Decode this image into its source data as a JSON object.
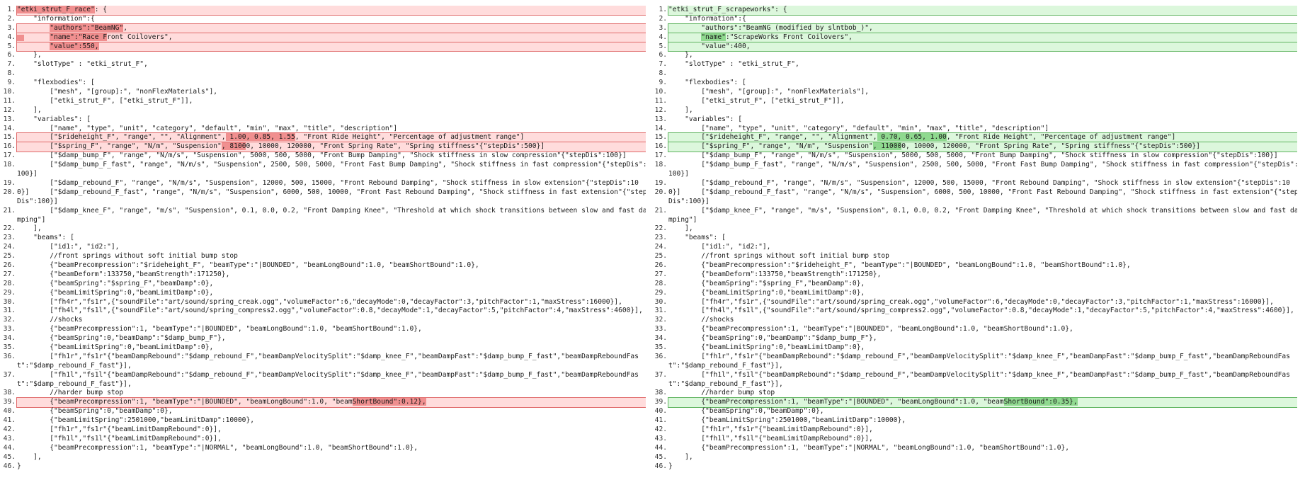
{
  "left": {
    "name": "left-pane",
    "lines": [
      {
        "n": "1.",
        "t": "\"etki_strut_F_race\": {",
        "k": "del",
        "h": [
          [
            0,
            19
          ]
        ]
      },
      {
        "n": "2.",
        "t": "    \"information\":{",
        "k": "n"
      },
      {
        "n": "3.",
        "t": "        \"authors\":\"BeamNG\",",
        "k": "del",
        "h": [
          [
            8,
            26
          ]
        ]
      },
      {
        "n": "4.",
        "t": "        \"name\":\"Race Front Coilovers\",",
        "k": "del",
        "h": [
          [
            8,
            22
          ]
        ],
        "g": true
      },
      {
        "n": "5.",
        "t": "        \"value\":550,",
        "k": "del",
        "h": [
          [
            8,
            20
          ]
        ]
      },
      {
        "n": "6.",
        "t": "    },",
        "k": "n"
      },
      {
        "n": "7.",
        "t": "    \"slotType\" : \"etki_strut_F\",",
        "k": "n"
      },
      {
        "n": "8.",
        "t": "",
        "k": "n"
      },
      {
        "n": "9.",
        "t": "    \"flexbodies\": [",
        "k": "n"
      },
      {
        "n": "10.",
        "t": "        [\"mesh\", \"[group]:\", \"nonFlexMaterials\"],",
        "k": "n"
      },
      {
        "n": "11.",
        "t": "        [\"etki_strut_F\", [\"etki_strut_F\"]],",
        "k": "n"
      },
      {
        "n": "12.",
        "t": "    ],",
        "k": "n"
      },
      {
        "n": "13.",
        "t": "    \"variables\": [",
        "k": "n"
      },
      {
        "n": "14.",
        "t": "        [\"name\", \"type\", \"unit\", \"category\", \"default\", \"min\", \"max\", \"title\", \"description\"]",
        "k": "n"
      },
      {
        "n": "15.",
        "t": "        [\"$rideheight_F\", \"range\", \"\", \"Alignment\", 1.00, 0.85, 1.55, \"Front Ride Height\", \"Percentage of adjustment range\"]",
        "k": "del",
        "h": [
          [
            51,
            68
          ]
        ]
      },
      {
        "n": "16.",
        "t": "        [\"$spring_F\", \"range\", \"N/m\", \"Suspension\", 81000, 10000, 120000, \"Front Spring Rate\", \"Spring stiffness\"{\"stepDis\":500}]",
        "k": "del",
        "h": [
          [
            50,
            56
          ]
        ]
      },
      {
        "n": "17.",
        "t": "        [\"$damp_bump_F\", \"range\", \"N/m/s\", \"Suspension\", 5000, 500, 5000, \"Front Bump Damping\", \"Shock stiffness in slow compression\"{\"stepDis\":100}]",
        "k": "n"
      },
      {
        "n": "18.",
        "t": "        [\"$damp_bump_F_fast\", \"range\", \"N/m/s\", \"Suspension\", 2500, 500, 5000, \"Front Fast Bump Damping\", \"Shock stiffness in fast compression\"{\"stepDis\":100}]",
        "k": "n",
        "tall": true
      },
      {
        "n": "19.",
        "t": "        [\"$damp_rebound_F\", \"range\", \"N/m/s\", \"Suspension\", 12000, 500, 15000, \"Front Rebound Damping\", \"Shock stiffness in slow extension\"{\"stepDis\":100}]",
        "k": "n"
      },
      {
        "n": "20.",
        "t": "        [\"$damp_rebound_F_fast\", \"range\", \"N/m/s\", \"Suspension\", 6000, 500, 10000, \"Front Fast Rebound Damping\", \"Shock stiffness in fast extension\"{\"stepDis\":100}]",
        "k": "n",
        "tall": true
      },
      {
        "n": "21.",
        "t": "        [\"$damp_knee_F\", \"range\", \"m/s\", \"Suspension\", 0.1, 0.0, 0.2, \"Front Damping Knee\", \"Threshold at which shock transitions between slow and fast damping\"]",
        "k": "n",
        "tall": true
      },
      {
        "n": "22.",
        "t": "    ],",
        "k": "n"
      },
      {
        "n": "23.",
        "t": "    \"beams\": [",
        "k": "n"
      },
      {
        "n": "24.",
        "t": "        [\"id1:\", \"id2:\"],",
        "k": "n"
      },
      {
        "n": "25.",
        "t": "        //front springs without soft initial bump stop",
        "k": "n"
      },
      {
        "n": "26.",
        "t": "        {\"beamPrecompression\":\"$rideheight_F\", \"beamType\":\"|BOUNDED\", \"beamLongBound\":1.0, \"beamShortBound\":1.0},",
        "k": "n"
      },
      {
        "n": "27.",
        "t": "        {\"beamDeform\":133750,\"beamStrength\":171250},",
        "k": "n"
      },
      {
        "n": "28.",
        "t": "        {\"beamSpring\":\"$spring_F\",\"beamDamp\":0},",
        "k": "n"
      },
      {
        "n": "29.",
        "t": "        {\"beamLimitSpring\":0,\"beamLimitDamp\":0},",
        "k": "n"
      },
      {
        "n": "30.",
        "t": "        [\"fh4r\",\"fs1r\",{\"soundFile\":\"art/sound/spring_creak.ogg\",\"volumeFactor\":6,\"decayMode\":0,\"decayFactor\":3,\"pitchFactor\":1,\"maxStress\":16000}],",
        "k": "n"
      },
      {
        "n": "31.",
        "t": "        [\"fh4l\",\"fs1l\",{\"soundFile\":\"art/sound/spring_compress2.ogg\",\"volumeFactor\":0.8,\"decayMode\":1,\"decayFactor\":5,\"pitchFactor\":4,\"maxStress\":4600}],",
        "k": "n"
      },
      {
        "n": "32.",
        "t": "        //shocks",
        "k": "n"
      },
      {
        "n": "33.",
        "t": "        {\"beamPrecompression\":1, \"beamType\":\"|BOUNDED\", \"beamLongBound\":1.0, \"beamShortBound\":1.0},",
        "k": "n"
      },
      {
        "n": "34.",
        "t": "        {\"beamSpring\":0,\"beamDamp\":\"$damp_bump_F\"},",
        "k": "n"
      },
      {
        "n": "35.",
        "t": "        {\"beamLimitSpring\":0,\"beamLimitDamp\":0},",
        "k": "n"
      },
      {
        "n": "36.",
        "t": "        [\"fh1r\",\"fs1r\"{\"beamDampRebound\":\"$damp_rebound_F\",\"beamDampVelocitySplit\":\"$damp_knee_F\",\"beamDampFast\":\"$damp_bump_F_fast\",\"beamDampReboundFast\":\"$damp_rebound_F_fast\"}],",
        "k": "n",
        "tall": true
      },
      {
        "n": "37.",
        "t": "        [\"fh1l\",\"fs1l\"{\"beamDampRebound\":\"$damp_rebound_F\",\"beamDampVelocitySplit\":\"$damp_knee_F\",\"beamDampFast\":\"$damp_bump_F_fast\",\"beamDampReboundFast\":\"$damp_rebound_F_fast\"}],",
        "k": "n",
        "tall": true
      },
      {
        "n": "38.",
        "t": "        //harder bump stop",
        "k": "n"
      },
      {
        "n": "39.",
        "t": "        {\"beamPrecompression\":1, \"beamType\":\"|BOUNDED\", \"beamLongBound\":1.0, \"beamShortBound\":0.12},",
        "k": "del",
        "h": [
          [
            82,
            103
          ]
        ]
      },
      {
        "n": "40.",
        "t": "        {\"beamSpring\":0,\"beamDamp\":0},",
        "k": "n"
      },
      {
        "n": "41.",
        "t": "        {\"beamLimitSpring\":2501000,\"beamLimitDamp\":10000},",
        "k": "n"
      },
      {
        "n": "42.",
        "t": "        [\"fh1r\",\"fs1r\"{\"beamLimitDampRebound\":0}],",
        "k": "n"
      },
      {
        "n": "43.",
        "t": "        [\"fh1l\",\"fs1l\"{\"beamLimitDampRebound\":0}],",
        "k": "n"
      },
      {
        "n": "44.",
        "t": "        {\"beamPrecompression\":1, \"beamType\":\"|NORMAL\", \"beamLongBound\":1.0, \"beamShortBound\":1.0},",
        "k": "n"
      },
      {
        "n": "45.",
        "t": "    ],",
        "k": "n"
      },
      {
        "n": "46.",
        "t": "}",
        "k": "n"
      }
    ]
  },
  "right": {
    "name": "right-pane",
    "lines": [
      {
        "n": "1.",
        "t": "\"etki_strut_F_scrapeworks\": {",
        "k": "add",
        "h": []
      },
      {
        "n": "2.",
        "t": "    \"information\":{",
        "k": "n"
      },
      {
        "n": "3.",
        "t": "        \"authors\":\"BeamNG (modified by slntbob_)\",",
        "k": "add",
        "h": []
      },
      {
        "n": "4.",
        "t": "        \"name\":\"ScrapeWorks Front Coilovers\",",
        "k": "add",
        "h": [
          [
            8,
            14
          ]
        ]
      },
      {
        "n": "5.",
        "t": "        \"value\":400,",
        "k": "add",
        "h": []
      },
      {
        "n": "6.",
        "t": "    },",
        "k": "n"
      },
      {
        "n": "7.",
        "t": "    \"slotType\" : \"etki_strut_F\",",
        "k": "n"
      },
      {
        "n": "8.",
        "t": "",
        "k": "n"
      },
      {
        "n": "9.",
        "t": "    \"flexbodies\": [",
        "k": "n"
      },
      {
        "n": "10.",
        "t": "        [\"mesh\", \"[group]:\", \"nonFlexMaterials\"],",
        "k": "n"
      },
      {
        "n": "11.",
        "t": "        [\"etki_strut_F\", [\"etki_strut_F\"]],",
        "k": "n"
      },
      {
        "n": "12.",
        "t": "    ],",
        "k": "n"
      },
      {
        "n": "13.",
        "t": "    \"variables\": [",
        "k": "n"
      },
      {
        "n": "14.",
        "t": "        [\"name\", \"type\", \"unit\", \"category\", \"default\", \"min\", \"max\", \"title\", \"description\"]",
        "k": "n"
      },
      {
        "n": "15.",
        "t": "        [\"$rideheight_F\", \"range\", \"\", \"Alignment\", 0.70, 0.65, 1.00, \"Front Ride Height\", \"Percentage of adjustment range\"]",
        "k": "add",
        "h": [
          [
            51,
            68
          ]
        ]
      },
      {
        "n": "16.",
        "t": "        [\"$spring_F\", \"range\", \"N/m\", \"Suspension\", 110000, 10000, 120000, \"Front Spring Rate\", \"Spring stiffness\"{\"stepDis\":500}]",
        "k": "add",
        "h": [
          [
            50,
            57
          ]
        ]
      },
      {
        "n": "17.",
        "t": "        [\"$damp_bump_F\", \"range\", \"N/m/s\", \"Suspension\", 5000, 500, 5000, \"Front Bump Damping\", \"Shock stiffness in slow compression\"{\"stepDis\":100}]",
        "k": "n"
      },
      {
        "n": "18.",
        "t": "        [\"$damp_bump_F_fast\", \"range\", \"N/m/s\", \"Suspension\", 2500, 500, 5000, \"Front Fast Bump Damping\", \"Shock stiffness in fast compression\"{\"stepDis\":100}]",
        "k": "n",
        "tall": true
      },
      {
        "n": "19.",
        "t": "        [\"$damp_rebound_F\", \"range\", \"N/m/s\", \"Suspension\", 12000, 500, 15000, \"Front Rebound Damping\", \"Shock stiffness in slow extension\"{\"stepDis\":100}]",
        "k": "n"
      },
      {
        "n": "20.",
        "t": "        [\"$damp_rebound_F_fast\", \"range\", \"N/m/s\", \"Suspension\", 6000, 500, 10000, \"Front Fast Rebound Damping\", \"Shock stiffness in fast extension\"{\"stepDis\":100}]",
        "k": "n",
        "tall": true
      },
      {
        "n": "21.",
        "t": "        [\"$damp_knee_F\", \"range\", \"m/s\", \"Suspension\", 0.1, 0.0, 0.2, \"Front Damping Knee\", \"Threshold at which shock transitions between slow and fast damping\"]",
        "k": "n",
        "tall": true
      },
      {
        "n": "22.",
        "t": "    ],",
        "k": "n"
      },
      {
        "n": "23.",
        "t": "    \"beams\": [",
        "k": "n"
      },
      {
        "n": "24.",
        "t": "        [\"id1:\", \"id2:\"],",
        "k": "n"
      },
      {
        "n": "25.",
        "t": "        //front springs without soft initial bump stop",
        "k": "n"
      },
      {
        "n": "26.",
        "t": "        {\"beamPrecompression\":\"$rideheight_F\", \"beamType\":\"|BOUNDED\", \"beamLongBound\":1.0, \"beamShortBound\":1.0},",
        "k": "n"
      },
      {
        "n": "27.",
        "t": "        {\"beamDeform\":133750,\"beamStrength\":171250},",
        "k": "n"
      },
      {
        "n": "28.",
        "t": "        {\"beamSpring\":\"$spring_F\",\"beamDamp\":0},",
        "k": "n"
      },
      {
        "n": "29.",
        "t": "        {\"beamLimitSpring\":0,\"beamLimitDamp\":0},",
        "k": "n"
      },
      {
        "n": "30.",
        "t": "        [\"fh4r\",\"fs1r\",{\"soundFile\":\"art/sound/spring_creak.ogg\",\"volumeFactor\":6,\"decayMode\":0,\"decayFactor\":3,\"pitchFactor\":1,\"maxStress\":16000}],",
        "k": "n"
      },
      {
        "n": "31.",
        "t": "        [\"fh4l\",\"fs1l\",{\"soundFile\":\"art/sound/spring_compress2.ogg\",\"volumeFactor\":0.8,\"decayMode\":1,\"decayFactor\":5,\"pitchFactor\":4,\"maxStress\":4600}],",
        "k": "n"
      },
      {
        "n": "32.",
        "t": "        //shocks",
        "k": "n"
      },
      {
        "n": "33.",
        "t": "        {\"beamPrecompression\":1, \"beamType\":\"|BOUNDED\", \"beamLongBound\":1.0, \"beamShortBound\":1.0},",
        "k": "n"
      },
      {
        "n": "34.",
        "t": "        {\"beamSpring\":0,\"beamDamp\":\"$damp_bump_F\"},",
        "k": "n"
      },
      {
        "n": "35.",
        "t": "        {\"beamLimitSpring\":0,\"beamLimitDamp\":0},",
        "k": "n"
      },
      {
        "n": "36.",
        "t": "        [\"fh1r\",\"fs1r\"{\"beamDampRebound\":\"$damp_rebound_F\",\"beamDampVelocitySplit\":\"$damp_knee_F\",\"beamDampFast\":\"$damp_bump_F_fast\",\"beamDampReboundFast\":\"$damp_rebound_F_fast\"}],",
        "k": "n",
        "tall": true
      },
      {
        "n": "37.",
        "t": "        [\"fh1l\",\"fs1l\"{\"beamDampRebound\":\"$damp_rebound_F\",\"beamDampVelocitySplit\":\"$damp_knee_F\",\"beamDampFast\":\"$damp_bump_F_fast\",\"beamDampReboundFast\":\"$damp_rebound_F_fast\"}],",
        "k": "n",
        "tall": true
      },
      {
        "n": "38.",
        "t": "        //harder bump stop",
        "k": "n"
      },
      {
        "n": "39.",
        "t": "        {\"beamPrecompression\":1, \"beamType\":\"|BOUNDED\", \"beamLongBound\":1.0, \"beamShortBound\":0.35},",
        "k": "add",
        "h": [
          [
            82,
            103
          ]
        ]
      },
      {
        "n": "40.",
        "t": "        {\"beamSpring\":0,\"beamDamp\":0},",
        "k": "n"
      },
      {
        "n": "41.",
        "t": "        {\"beamLimitSpring\":2501000,\"beamLimitDamp\":10000},",
        "k": "n"
      },
      {
        "n": "42.",
        "t": "        [\"fh1r\",\"fs1r\"{\"beamLimitDampRebound\":0}],",
        "k": "n"
      },
      {
        "n": "43.",
        "t": "        [\"fh1l\",\"fs1l\"{\"beamLimitDampRebound\":0}],",
        "k": "n"
      },
      {
        "n": "44.",
        "t": "        {\"beamPrecompression\":1, \"beamType\":\"|NORMAL\", \"beamLongBound\":1.0, \"beamShortBound\":1.0},",
        "k": "n"
      },
      {
        "n": "45.",
        "t": "    ],",
        "k": "n"
      },
      {
        "n": "46.",
        "t": "}",
        "k": "n"
      }
    ]
  }
}
